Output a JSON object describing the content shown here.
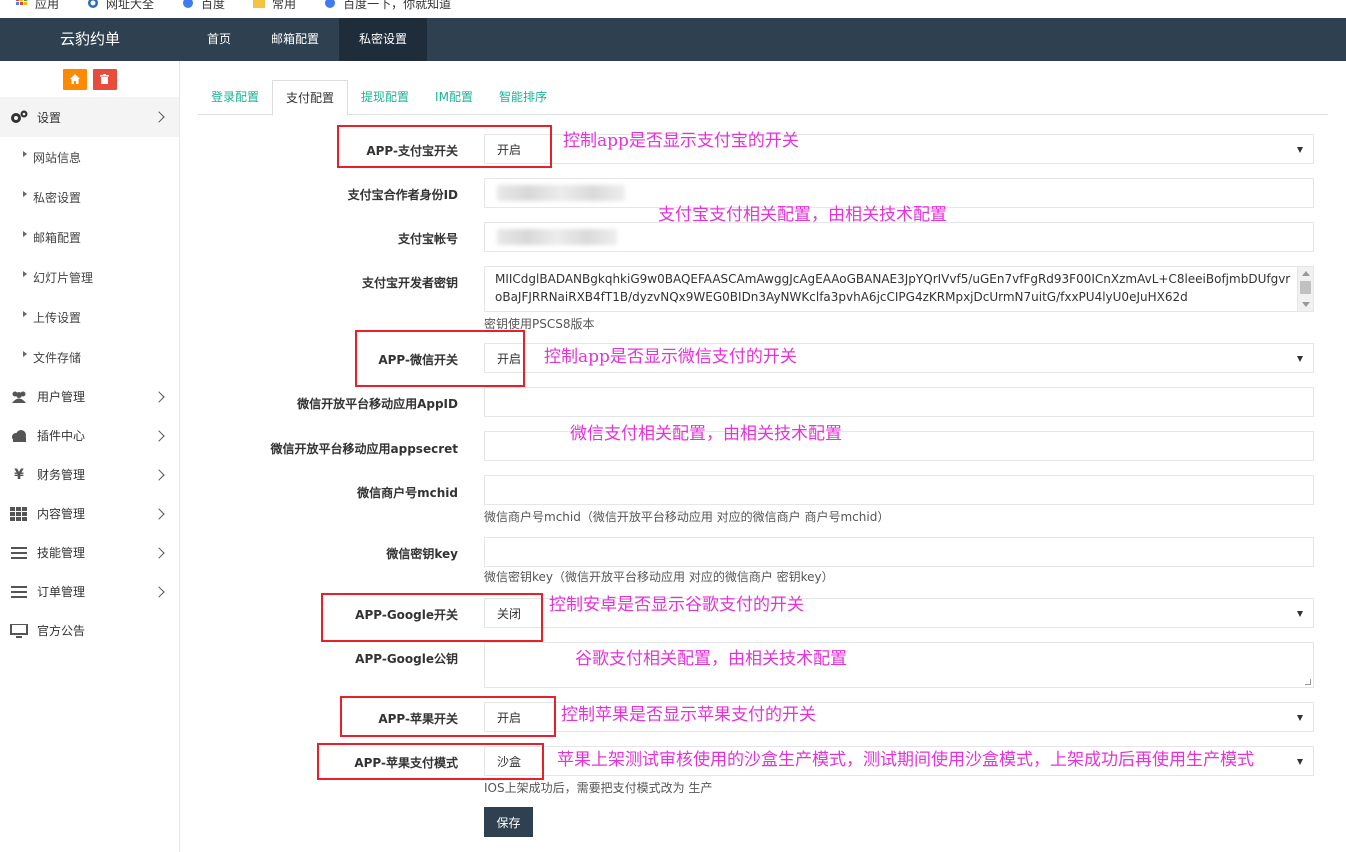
{
  "bookmarks": [
    {
      "icon": "apps-grid-icon",
      "label": "应用"
    },
    {
      "icon": "globe-icon",
      "label": "网址大全"
    },
    {
      "icon": "paw-icon",
      "label": "百度"
    },
    {
      "icon": "folder-icon",
      "label": "常用"
    },
    {
      "icon": "paw-icon",
      "label": "百度一下，你就知道"
    }
  ],
  "brand": "云豹约单",
  "nav": [
    {
      "label": "首页"
    },
    {
      "label": "邮箱配置"
    },
    {
      "label": "私密设置",
      "active": true
    }
  ],
  "sidebar": {
    "actions": [
      {
        "icon": "home-icon",
        "color": "#ff8a00"
      },
      {
        "icon": "trash-icon",
        "color": "#e84c3d"
      }
    ],
    "settings": {
      "label": "设置",
      "icon": "gears-icon"
    },
    "sub_items": [
      "网站信息",
      "私密设置",
      "邮箱配置",
      "幻灯片管理",
      "上传设置",
      "文件存储"
    ],
    "menu": [
      {
        "label": "用户管理",
        "icon": "users-icon",
        "arrow": true
      },
      {
        "label": "插件中心",
        "icon": "cloud-icon",
        "arrow": true
      },
      {
        "label": "财务管理",
        "icon": "yen-icon",
        "arrow": true
      },
      {
        "label": "内容管理",
        "icon": "grid-icon",
        "arrow": true
      },
      {
        "label": "技能管理",
        "icon": "list-icon",
        "arrow": true
      },
      {
        "label": "订单管理",
        "icon": "list-icon",
        "arrow": true
      },
      {
        "label": "官方公告",
        "icon": "monitor-icon",
        "arrow": false
      }
    ]
  },
  "tabs": [
    {
      "label": "登录配置"
    },
    {
      "label": "支付配置",
      "active": true
    },
    {
      "label": "提现配置"
    },
    {
      "label": "IM配置"
    },
    {
      "label": "智能排序"
    }
  ],
  "form": {
    "alipay_switch": {
      "label": "APP-支付宝开关",
      "value": "开启"
    },
    "alipay_partner_id": {
      "label": "支付宝合作者身份ID"
    },
    "alipay_account": {
      "label": "支付宝帐号"
    },
    "alipay_dev_key": {
      "label": "支付宝开发者密钥",
      "value": "MIICdglBADANBgkqhkiG9w0BAQEFAASCAmAwggJcAgEAAoGBANAE3JpYQrIVvf5/uGEn7vfFgRd93F00ICnXzmAvL+C8leeiBofjmbDUfgvroBaJFJRRNaiRXB4fT1B/dyzvNQx9WEG0BIDn3AyNWKclfa3pvhA6jcCIPG4zKRMpxjDcUrmN7uitG/fxxPU4lyU0eJuHX62d",
      "help": "密钥使用PSCS8版本"
    },
    "wechat_switch": {
      "label": "APP-微信开关",
      "value": "开启"
    },
    "wechat_appid": {
      "label": "微信开放平台移动应用AppID"
    },
    "wechat_appsecret": {
      "label": "微信开放平台移动应用appsecret"
    },
    "wechat_mchid": {
      "label": "微信商户号mchid",
      "help": "微信商户号mchid（微信开放平台移动应用 对应的微信商户 商户号mchid）"
    },
    "wechat_key": {
      "label": "微信密钥key",
      "help": "微信密钥key（微信开放平台移动应用 对应的微信商户 密钥key）"
    },
    "google_switch": {
      "label": "APP-Google开关",
      "value": "关闭"
    },
    "google_pubkey": {
      "label": "APP-Google公钥"
    },
    "apple_switch": {
      "label": "APP-苹果开关",
      "value": "开启"
    },
    "apple_mode": {
      "label": "APP-苹果支付模式",
      "value": "沙盒",
      "help": "IOS上架成功后，需要把支付模式改为 生产"
    },
    "save_label": "保存"
  },
  "annotations": {
    "alipay_switch": "控制app是否显示支付宝的开关",
    "alipay_config": "支付宝支付相关配置，由相关技术配置",
    "wechat_switch": "控制app是否显示微信支付的开关",
    "wechat_config": "微信支付相关配置，由相关技术配置",
    "google_switch": "控制安卓是否显示谷歌支付的开关",
    "google_config": "谷歌支付相关配置，由相关技术配置",
    "apple_switch": "控制苹果是否显示苹果支付的开关",
    "apple_mode": "苹果上架测试审核使用的沙盒生产模式，测试期间使用沙盒模式，上架成功后再使用生产模式"
  },
  "colors": {
    "topbar": "#2f4050",
    "accent": "#1ab394",
    "annotation": "#e632d8",
    "annotation_box": "#e8202a"
  }
}
